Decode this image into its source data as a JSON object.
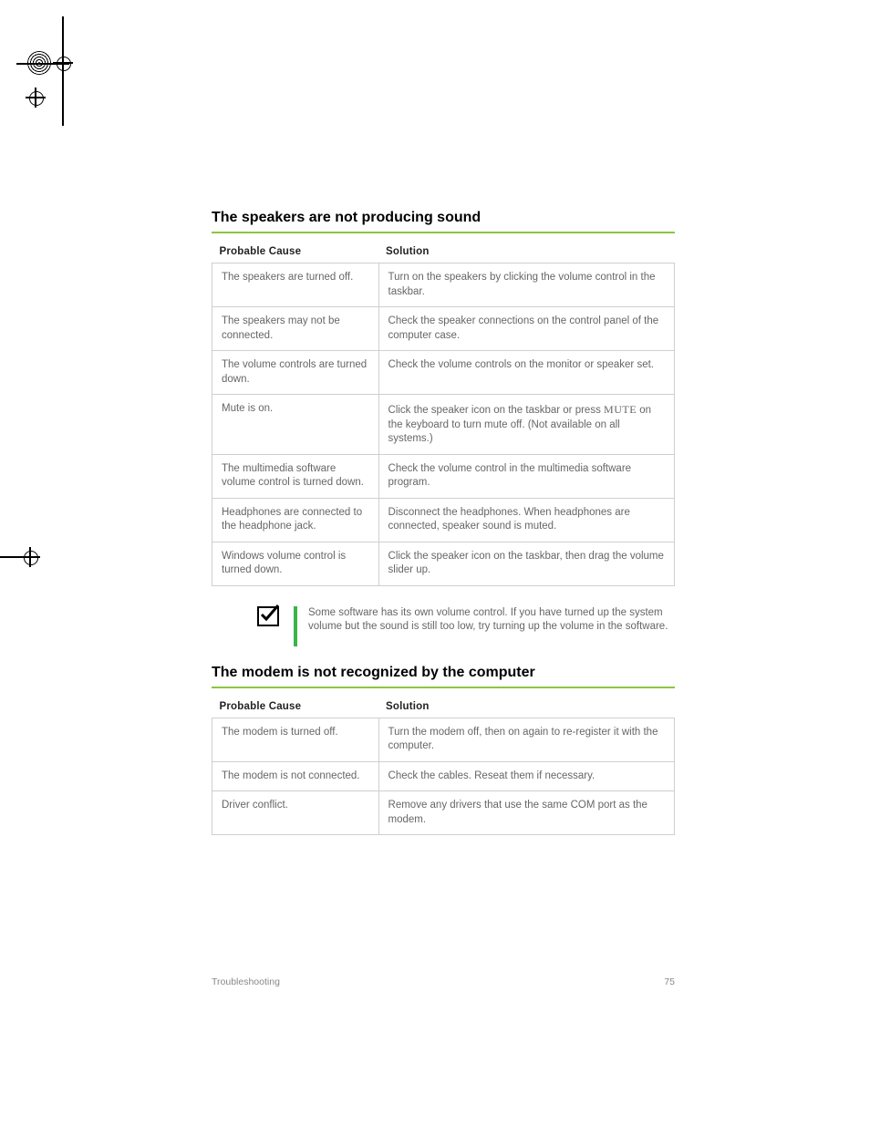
{
  "sections": [
    {
      "title": "The speakers are not producing sound",
      "headers": {
        "cause": "Probable Cause",
        "solution": "Solution"
      },
      "rows": [
        {
          "cause": "The speakers are turned off.",
          "solution": "Turn on the speakers by clicking the volume control in the taskbar."
        },
        {
          "cause": "The speakers may not be connected.",
          "solution": "Check the speaker connections on the control panel of the computer case."
        },
        {
          "cause": "The volume controls are turned down.",
          "solution": "Check the volume controls on the monitor or speaker set."
        },
        {
          "cause": "Mute is on.",
          "solution_pre": "Click the speaker icon on the taskbar or press ",
          "solution_mid": "MUTE",
          "solution_post": " on the keyboard to turn mute off. (Not available on all systems.)"
        },
        {
          "cause": "The multimedia software volume control is turned down.",
          "solution": "Check the volume control in the multimedia software program."
        },
        {
          "cause": "Headphones are connected to the headphone jack.",
          "solution": "Disconnect the headphones. When headphones are connected, speaker sound is muted."
        },
        {
          "cause": "Windows volume control is turned down.",
          "solution": "Click the speaker icon on the taskbar, then drag the volume slider up."
        }
      ]
    },
    {
      "note": "Some software has its own volume control. If you have turned up the system volume but the sound is still too low, try turning up the volume in the software.",
      "title": "The modem is not recognized by the computer",
      "headers": {
        "cause": "Probable Cause",
        "solution": "Solution"
      },
      "rows": [
        {
          "cause": "The modem is turned off.",
          "solution": "Turn the modem off, then on again to re-register it with the computer."
        },
        {
          "cause": "The modem is not connected.",
          "solution": "Check the cables. Reseat them if necessary."
        },
        {
          "cause": "Driver conflict.",
          "solution": "Remove any drivers that use the same COM port as the modem."
        }
      ]
    }
  ],
  "footer": {
    "left": "Troubleshooting",
    "right": "75"
  }
}
